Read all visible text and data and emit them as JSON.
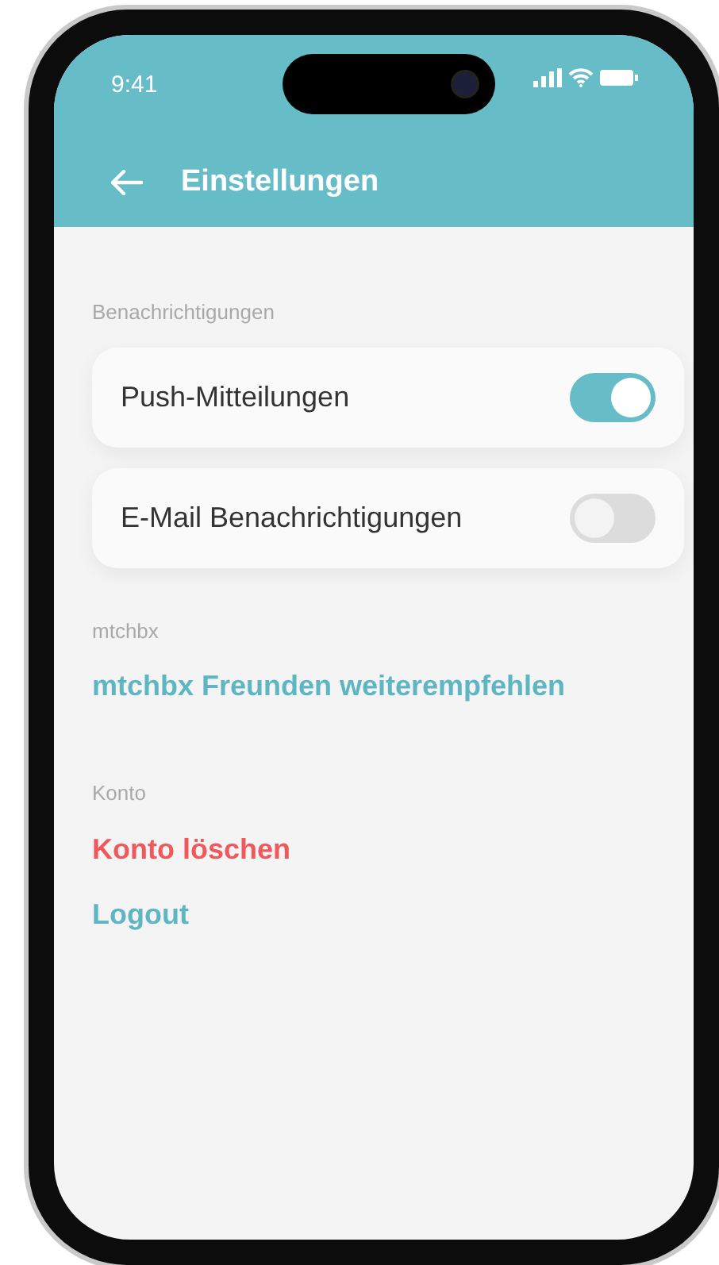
{
  "status_bar": {
    "time": "9:41"
  },
  "header": {
    "title": "Einstellungen"
  },
  "sections": [
    {
      "title": "Benachrichtigungen",
      "items": [
        {
          "kind": "toggle",
          "label": "Push-Mitteilungen",
          "on": true
        },
        {
          "kind": "toggle",
          "label": "E-Mail Benachrichtigungen",
          "on": false
        }
      ]
    },
    {
      "title": "mtchbx",
      "items": [
        {
          "kind": "link",
          "label": "mtchbx Freunden weiterempfehlen"
        }
      ]
    },
    {
      "title": "Konto",
      "items": [
        {
          "kind": "destructive",
          "label": "Konto löschen"
        },
        {
          "kind": "link",
          "label": "Logout"
        }
      ]
    }
  ]
}
